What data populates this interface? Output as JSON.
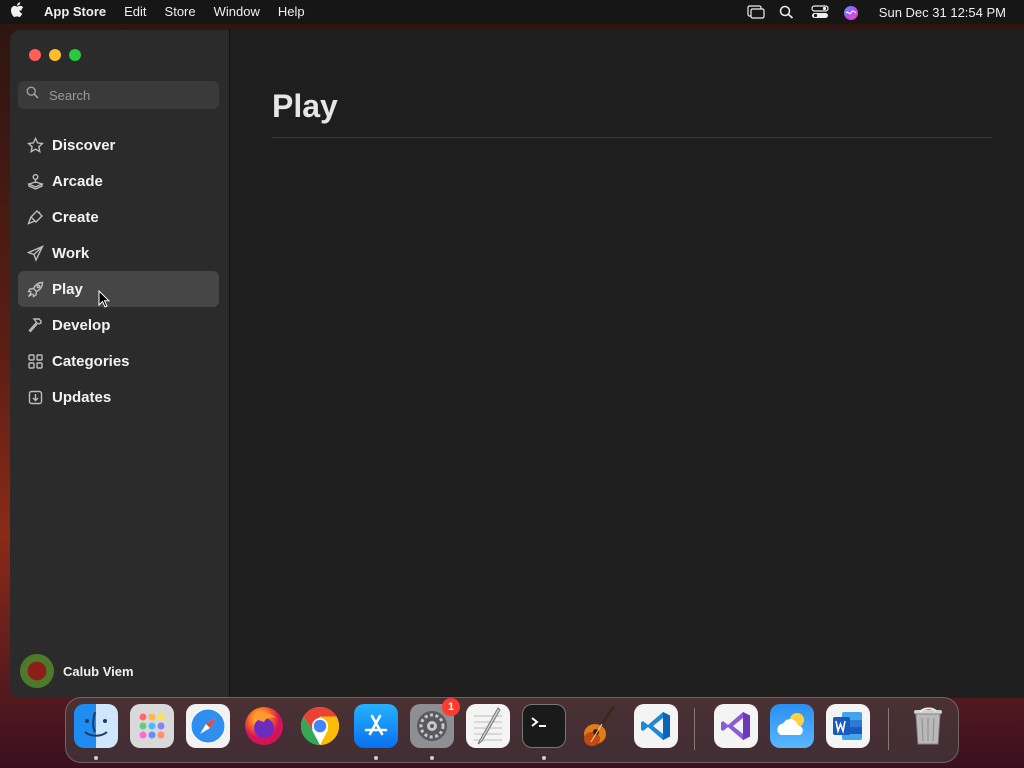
{
  "menubar": {
    "app_name": "App Store",
    "menus": [
      "Edit",
      "Store",
      "Window",
      "Help"
    ],
    "clock": "Sun Dec 31  12:54 PM"
  },
  "sidebar": {
    "search_placeholder": "Search",
    "items": [
      {
        "label": "Discover",
        "icon": "star-icon"
      },
      {
        "label": "Arcade",
        "icon": "joystick-icon"
      },
      {
        "label": "Create",
        "icon": "brush-icon"
      },
      {
        "label": "Work",
        "icon": "paper-plane-icon"
      },
      {
        "label": "Play",
        "icon": "rocket-icon",
        "active": true
      },
      {
        "label": "Develop",
        "icon": "hammer-icon"
      },
      {
        "label": "Categories",
        "icon": "grid-icon"
      },
      {
        "label": "Updates",
        "icon": "download-icon"
      }
    ],
    "account_name": "Calub Viem"
  },
  "main": {
    "title": "Play"
  },
  "dock": {
    "apps": [
      "Finder",
      "Launchpad",
      "Safari",
      "Firefox",
      "Chrome",
      "App Store",
      "System Settings",
      "TextEdit",
      "Terminal",
      "GarageBand",
      "Visual Studio Code",
      "Visual Studio",
      "Weather",
      "Microsoft Word",
      "Trash"
    ],
    "settings_badge": "1"
  },
  "colors": {
    "accent_red": "#ff5f57",
    "accent_yellow": "#febc2e",
    "accent_green": "#28c840",
    "sidebar_bg": "#2b2b2b",
    "main_bg": "#1e1e1e"
  }
}
